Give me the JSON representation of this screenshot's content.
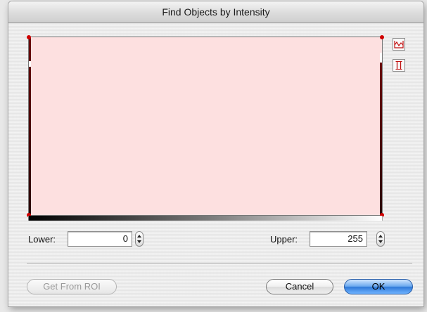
{
  "window": {
    "title": "Find Objects by Intensity"
  },
  "plot": {
    "fill_color": "#fde0e0",
    "edge_color": "#4a0505",
    "handle_color": "#d00000"
  },
  "side_buttons": [
    {
      "icon": "histogram-range-icon"
    },
    {
      "icon": "threshold-lines-icon"
    }
  ],
  "range": {
    "lower_label": "Lower:",
    "lower_value": "0",
    "upper_label": "Upper:",
    "upper_value": "255"
  },
  "buttons": {
    "get_from_roi": "Get From ROI",
    "cancel": "Cancel",
    "ok": "OK"
  }
}
